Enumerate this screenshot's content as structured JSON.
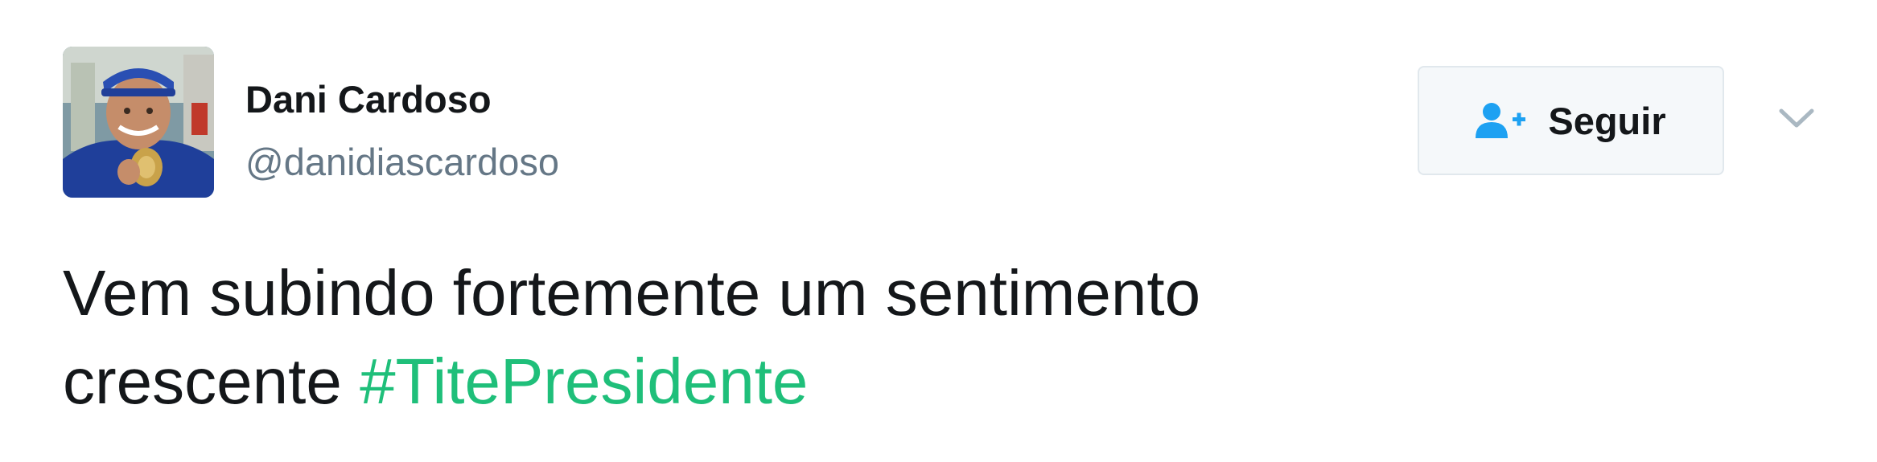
{
  "user": {
    "display_name": "Dani Cardoso",
    "handle": "@danidiascardoso"
  },
  "follow_button": {
    "label": "Seguir",
    "icon": "follow-user-icon"
  },
  "menu": {
    "icon": "chevron-down-icon"
  },
  "tweet": {
    "line1": "Vem subindo fortemente um sentimento",
    "line2_text": "crescente ",
    "hashtag": "#TitePresidente"
  },
  "colors": {
    "hashtag": "#1fbf7a",
    "follow_icon": "#1da1f2",
    "handle": "#657786",
    "text": "#14171a",
    "button_bg": "#f5f8fa",
    "button_border": "#e1e8ed"
  }
}
